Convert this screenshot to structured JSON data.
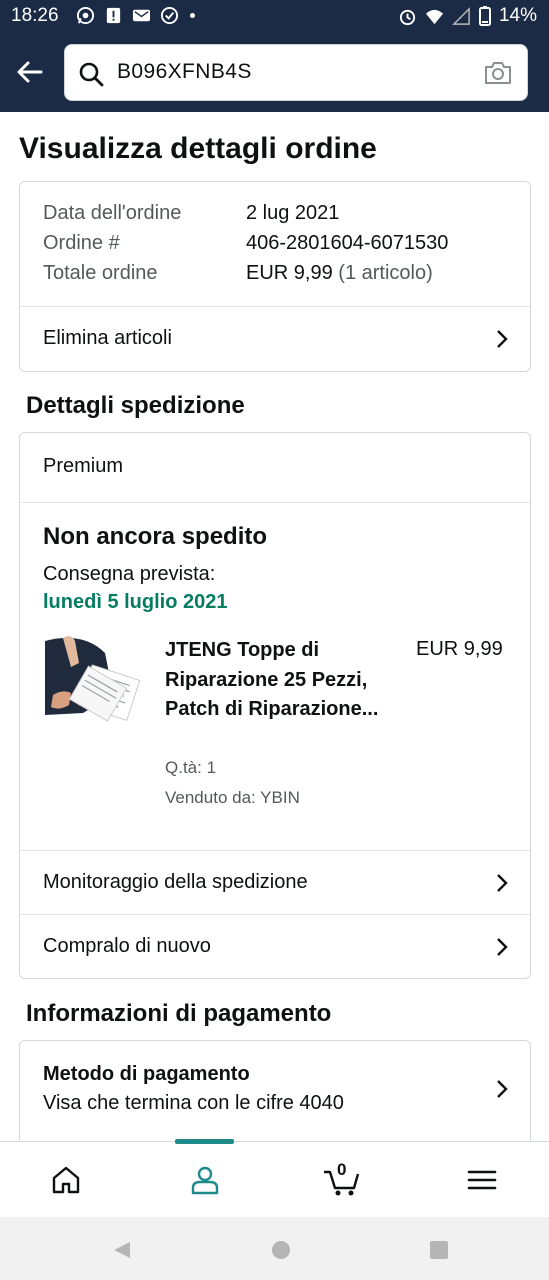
{
  "status_bar": {
    "time": "18:26",
    "battery": "14%",
    "icons": [
      "whatsapp-icon",
      "alert-icon",
      "message-icon",
      "check-circle-icon",
      "alarm-icon",
      "wifi-icon",
      "signal-icon",
      "battery-icon"
    ]
  },
  "header": {
    "search_query": "B096XFNB4S",
    "icons": [
      "back-arrow-icon",
      "search-icon",
      "camera-icon"
    ]
  },
  "page": {
    "title": "Visualizza dettagli ordine"
  },
  "order_summary": {
    "date_label": "Data dell'ordine",
    "date_value": "2 lug 2021",
    "order_label": "Ordine #",
    "order_value": "406-2801604-6071530",
    "total_label": "Totale ordine",
    "total_value": "EUR 9,99",
    "total_count": "(1 articolo)",
    "delete_items": "Elimina articoli"
  },
  "shipment": {
    "section_title": "Dettagli spedizione",
    "shipping_type": "Premium",
    "status": "Non ancora spedito",
    "delivery_label": "Consegna prevista:",
    "delivery_date": "lunedì 5 luglio 2021",
    "product": {
      "name": "JTENG Toppe di Riparazione 25 Pezzi, Patch di Riparazione...",
      "price": "EUR 9,99",
      "quantity": "Q.tà: 1",
      "seller": "Venduto da: YBIN"
    },
    "track_link": "Monitoraggio della spedizione",
    "buy_again": "Compralo di nuovo"
  },
  "payment": {
    "section_title": "Informazioni di pagamento",
    "method_title": "Metodo di pagamento",
    "method_value": "Visa che termina con le cifre 4040"
  },
  "bottom_nav": {
    "cart_count": "0",
    "active_tab": "account",
    "accent_color": "#1f8a8a"
  },
  "colors": {
    "header_bg": "#1c2b45",
    "delivery_green": "#067d62"
  }
}
